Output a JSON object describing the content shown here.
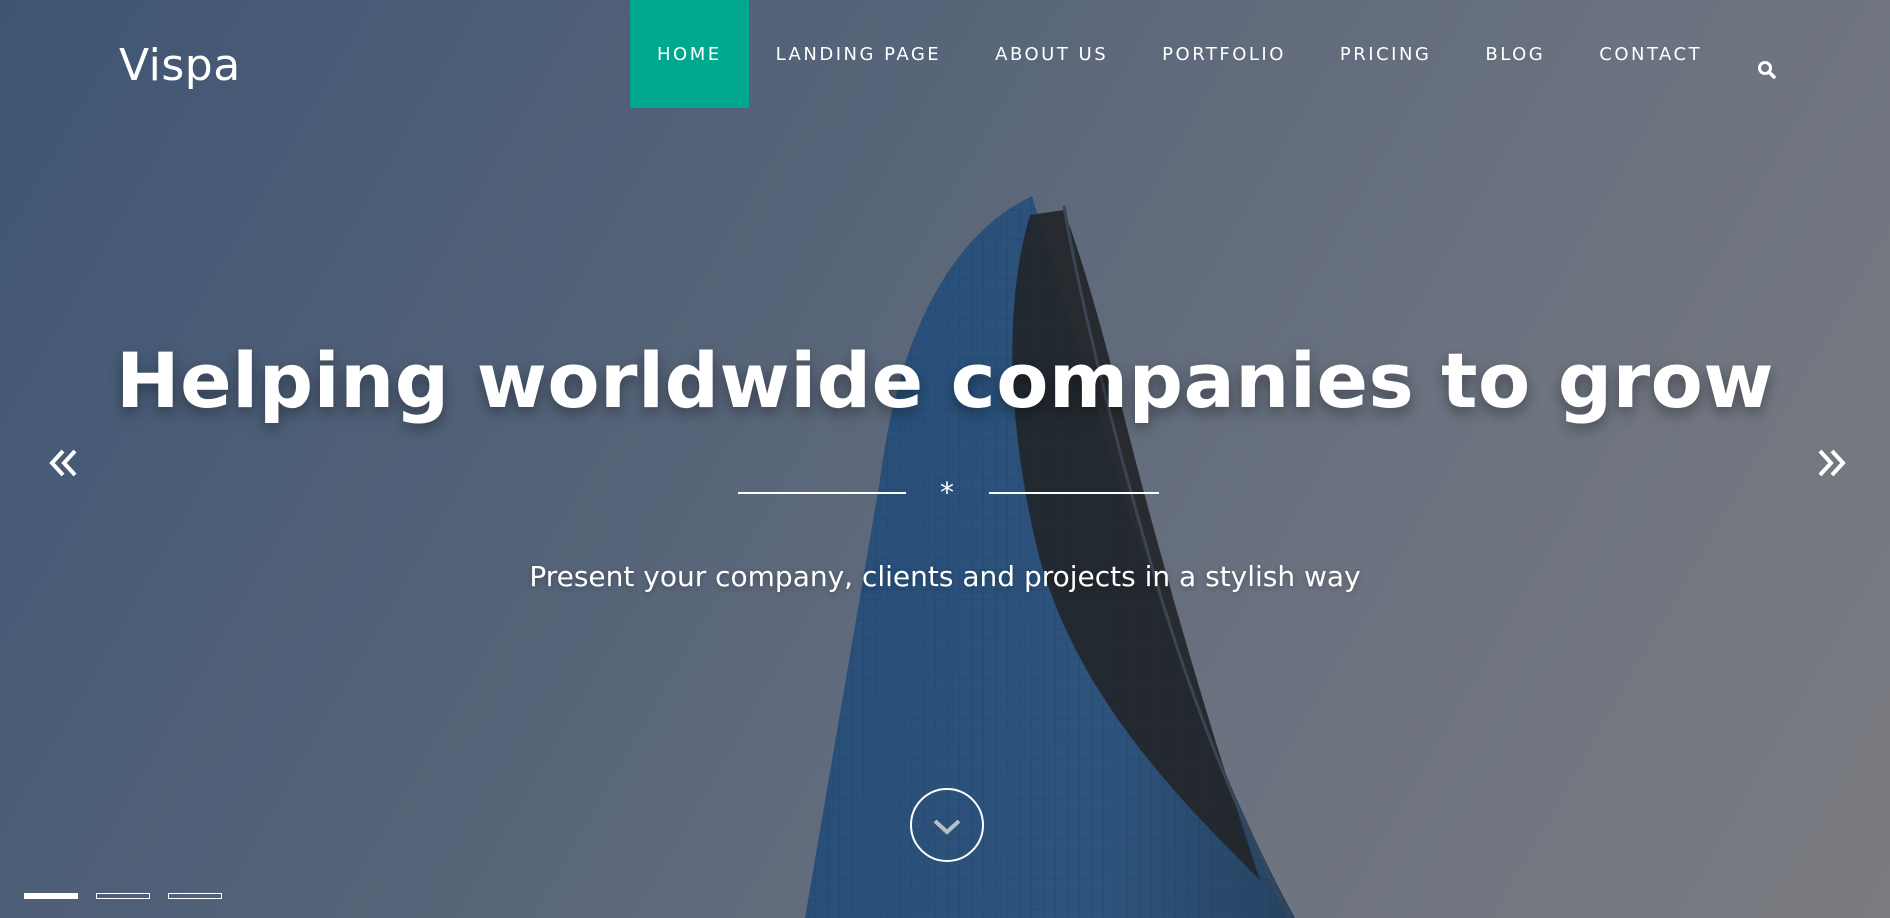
{
  "brand": {
    "logo_text": "Vispa"
  },
  "nav": {
    "items": [
      {
        "label": "HOME",
        "active": true
      },
      {
        "label": "LANDING PAGE",
        "active": false
      },
      {
        "label": "ABOUT US",
        "active": false
      },
      {
        "label": "PORTFOLIO",
        "active": false
      },
      {
        "label": "PRICING",
        "active": false
      },
      {
        "label": "BLOG",
        "active": false
      },
      {
        "label": "CONTACT",
        "active": false
      }
    ],
    "search_icon": "search-icon",
    "active_color": "#00a88f"
  },
  "hero": {
    "headline": "Helping worldwide companies to grow",
    "divider_symbol": "*",
    "subtitle": "Present your company, clients and projects in a stylish way",
    "prev_icon": "double-chevron-left-icon",
    "next_icon": "double-chevron-right-icon",
    "scroll_icon": "chevron-down-icon"
  },
  "slider": {
    "slide_count": 3,
    "active_index": 0
  }
}
